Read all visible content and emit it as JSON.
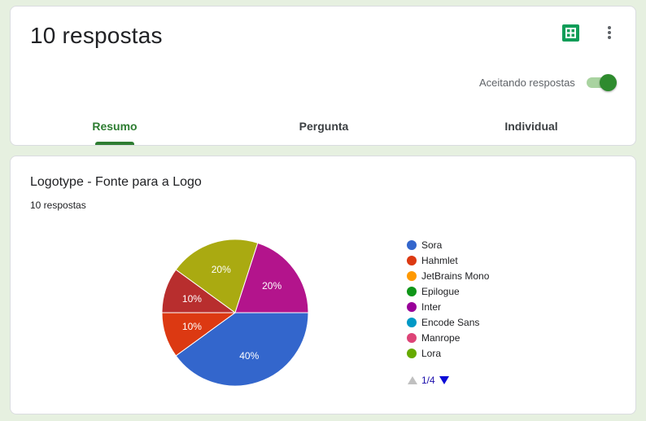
{
  "header": {
    "title": "10 respostas",
    "accepting_label": "Aceitando respostas",
    "accepting_on": true,
    "sheets_icon": "sheets-icon",
    "menu_icon": "more-vert-icon"
  },
  "tabs": [
    {
      "label": "Resumo",
      "active": true
    },
    {
      "label": "Pergunta",
      "active": false
    },
    {
      "label": "Individual",
      "active": false
    }
  ],
  "question": {
    "title": "Logotype - Fonte para a Logo",
    "responses": "10 respostas"
  },
  "colors": {
    "accent": "#2e7d32",
    "background": "#e6f0e0"
  },
  "chart_data": {
    "type": "pie",
    "categories": [
      "Sora",
      "Hahmlet",
      "JetBrains Mono",
      "Epilogue",
      "Inter",
      "Encode Sans",
      "Manrope",
      "Lora"
    ],
    "colors": [
      "#3366cc",
      "#dc3912",
      "#ff9900",
      "#109618",
      "#990099",
      "#0099c6",
      "#dd4477",
      "#66aa00"
    ],
    "slices": [
      {
        "label": "40%",
        "value": 40,
        "color": "#3366cc"
      },
      {
        "label": "10%",
        "value": 10,
        "color": "#dc3912"
      },
      {
        "label": "10%",
        "value": 10,
        "color": "#b82e2e"
      },
      {
        "label": "20%",
        "value": 20,
        "color": "#aaaa11"
      },
      {
        "label": "20%",
        "value": 20,
        "color": "#b3148c"
      }
    ],
    "legend_placement": "right",
    "legend_page": "1/4"
  }
}
